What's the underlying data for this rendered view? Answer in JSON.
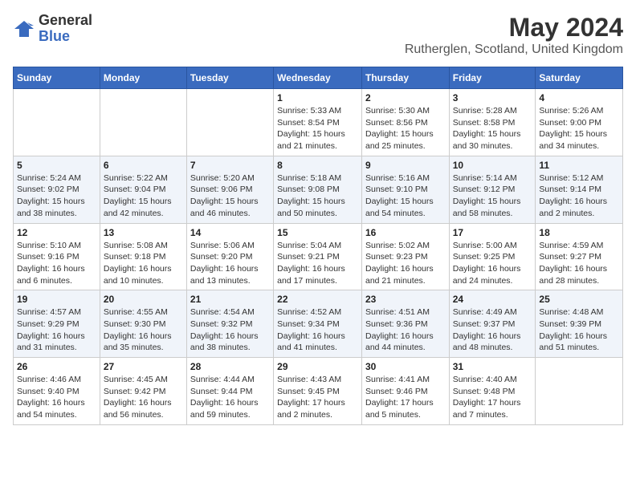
{
  "header": {
    "logo_general": "General",
    "logo_blue": "Blue",
    "month_year": "May 2024",
    "location": "Rutherglen, Scotland, United Kingdom"
  },
  "days_of_week": [
    "Sunday",
    "Monday",
    "Tuesday",
    "Wednesday",
    "Thursday",
    "Friday",
    "Saturday"
  ],
  "weeks": [
    [
      {
        "day": "",
        "info": ""
      },
      {
        "day": "",
        "info": ""
      },
      {
        "day": "",
        "info": ""
      },
      {
        "day": "1",
        "info": "Sunrise: 5:33 AM\nSunset: 8:54 PM\nDaylight: 15 hours and 21 minutes."
      },
      {
        "day": "2",
        "info": "Sunrise: 5:30 AM\nSunset: 8:56 PM\nDaylight: 15 hours and 25 minutes."
      },
      {
        "day": "3",
        "info": "Sunrise: 5:28 AM\nSunset: 8:58 PM\nDaylight: 15 hours and 30 minutes."
      },
      {
        "day": "4",
        "info": "Sunrise: 5:26 AM\nSunset: 9:00 PM\nDaylight: 15 hours and 34 minutes."
      }
    ],
    [
      {
        "day": "5",
        "info": "Sunrise: 5:24 AM\nSunset: 9:02 PM\nDaylight: 15 hours and 38 minutes."
      },
      {
        "day": "6",
        "info": "Sunrise: 5:22 AM\nSunset: 9:04 PM\nDaylight: 15 hours and 42 minutes."
      },
      {
        "day": "7",
        "info": "Sunrise: 5:20 AM\nSunset: 9:06 PM\nDaylight: 15 hours and 46 minutes."
      },
      {
        "day": "8",
        "info": "Sunrise: 5:18 AM\nSunset: 9:08 PM\nDaylight: 15 hours and 50 minutes."
      },
      {
        "day": "9",
        "info": "Sunrise: 5:16 AM\nSunset: 9:10 PM\nDaylight: 15 hours and 54 minutes."
      },
      {
        "day": "10",
        "info": "Sunrise: 5:14 AM\nSunset: 9:12 PM\nDaylight: 15 hours and 58 minutes."
      },
      {
        "day": "11",
        "info": "Sunrise: 5:12 AM\nSunset: 9:14 PM\nDaylight: 16 hours and 2 minutes."
      }
    ],
    [
      {
        "day": "12",
        "info": "Sunrise: 5:10 AM\nSunset: 9:16 PM\nDaylight: 16 hours and 6 minutes."
      },
      {
        "day": "13",
        "info": "Sunrise: 5:08 AM\nSunset: 9:18 PM\nDaylight: 16 hours and 10 minutes."
      },
      {
        "day": "14",
        "info": "Sunrise: 5:06 AM\nSunset: 9:20 PM\nDaylight: 16 hours and 13 minutes."
      },
      {
        "day": "15",
        "info": "Sunrise: 5:04 AM\nSunset: 9:21 PM\nDaylight: 16 hours and 17 minutes."
      },
      {
        "day": "16",
        "info": "Sunrise: 5:02 AM\nSunset: 9:23 PM\nDaylight: 16 hours and 21 minutes."
      },
      {
        "day": "17",
        "info": "Sunrise: 5:00 AM\nSunset: 9:25 PM\nDaylight: 16 hours and 24 minutes."
      },
      {
        "day": "18",
        "info": "Sunrise: 4:59 AM\nSunset: 9:27 PM\nDaylight: 16 hours and 28 minutes."
      }
    ],
    [
      {
        "day": "19",
        "info": "Sunrise: 4:57 AM\nSunset: 9:29 PM\nDaylight: 16 hours and 31 minutes."
      },
      {
        "day": "20",
        "info": "Sunrise: 4:55 AM\nSunset: 9:30 PM\nDaylight: 16 hours and 35 minutes."
      },
      {
        "day": "21",
        "info": "Sunrise: 4:54 AM\nSunset: 9:32 PM\nDaylight: 16 hours and 38 minutes."
      },
      {
        "day": "22",
        "info": "Sunrise: 4:52 AM\nSunset: 9:34 PM\nDaylight: 16 hours and 41 minutes."
      },
      {
        "day": "23",
        "info": "Sunrise: 4:51 AM\nSunset: 9:36 PM\nDaylight: 16 hours and 44 minutes."
      },
      {
        "day": "24",
        "info": "Sunrise: 4:49 AM\nSunset: 9:37 PM\nDaylight: 16 hours and 48 minutes."
      },
      {
        "day": "25",
        "info": "Sunrise: 4:48 AM\nSunset: 9:39 PM\nDaylight: 16 hours and 51 minutes."
      }
    ],
    [
      {
        "day": "26",
        "info": "Sunrise: 4:46 AM\nSunset: 9:40 PM\nDaylight: 16 hours and 54 minutes."
      },
      {
        "day": "27",
        "info": "Sunrise: 4:45 AM\nSunset: 9:42 PM\nDaylight: 16 hours and 56 minutes."
      },
      {
        "day": "28",
        "info": "Sunrise: 4:44 AM\nSunset: 9:44 PM\nDaylight: 16 hours and 59 minutes."
      },
      {
        "day": "29",
        "info": "Sunrise: 4:43 AM\nSunset: 9:45 PM\nDaylight: 17 hours and 2 minutes."
      },
      {
        "day": "30",
        "info": "Sunrise: 4:41 AM\nSunset: 9:46 PM\nDaylight: 17 hours and 5 minutes."
      },
      {
        "day": "31",
        "info": "Sunrise: 4:40 AM\nSunset: 9:48 PM\nDaylight: 17 hours and 7 minutes."
      },
      {
        "day": "",
        "info": ""
      }
    ]
  ]
}
